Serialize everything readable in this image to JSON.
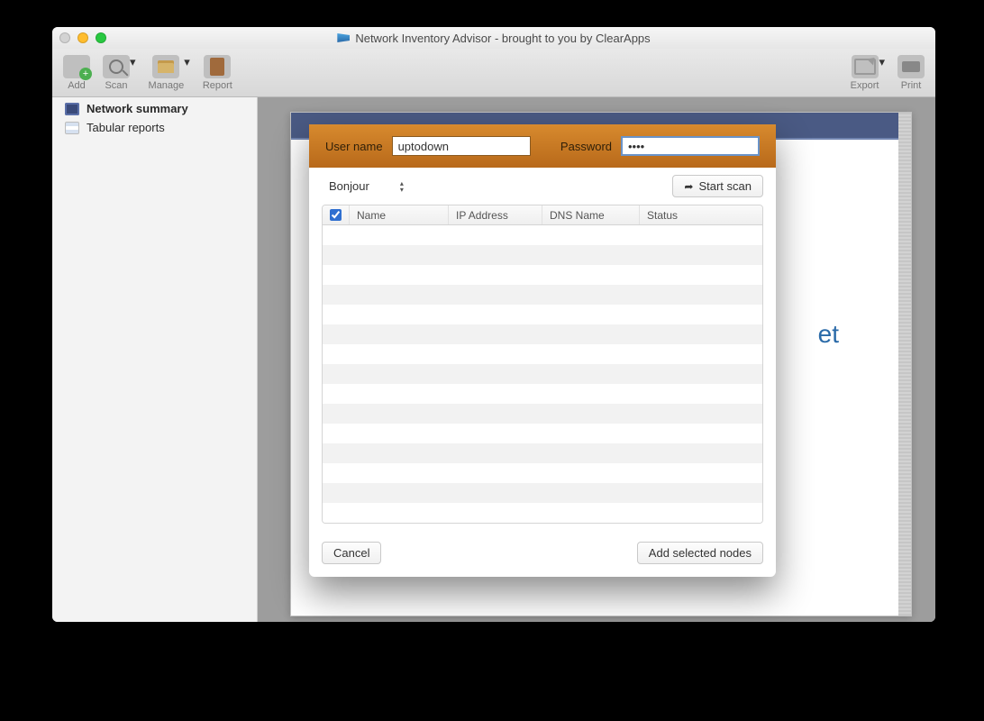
{
  "window": {
    "title": "Network Inventory Advisor - brought to you by ClearApps"
  },
  "toolbar": {
    "add": "Add",
    "scan": "Scan",
    "manage": "Manage",
    "report": "Report",
    "export": "Export",
    "print": "Print"
  },
  "sidebar": {
    "items": [
      {
        "label": "Network summary"
      },
      {
        "label": "Tabular reports"
      }
    ]
  },
  "doc": {
    "partial_text": "et"
  },
  "dialog": {
    "username_label": "User name",
    "username_value": "uptodown",
    "password_label": "Password",
    "password_value": "••••",
    "method_selected": "Bonjour",
    "start_scan": "Start scan",
    "columns": {
      "name": "Name",
      "ip": "IP Address",
      "dns": "DNS Name",
      "status": "Status"
    },
    "cancel": "Cancel",
    "add_selected": "Add selected nodes"
  }
}
